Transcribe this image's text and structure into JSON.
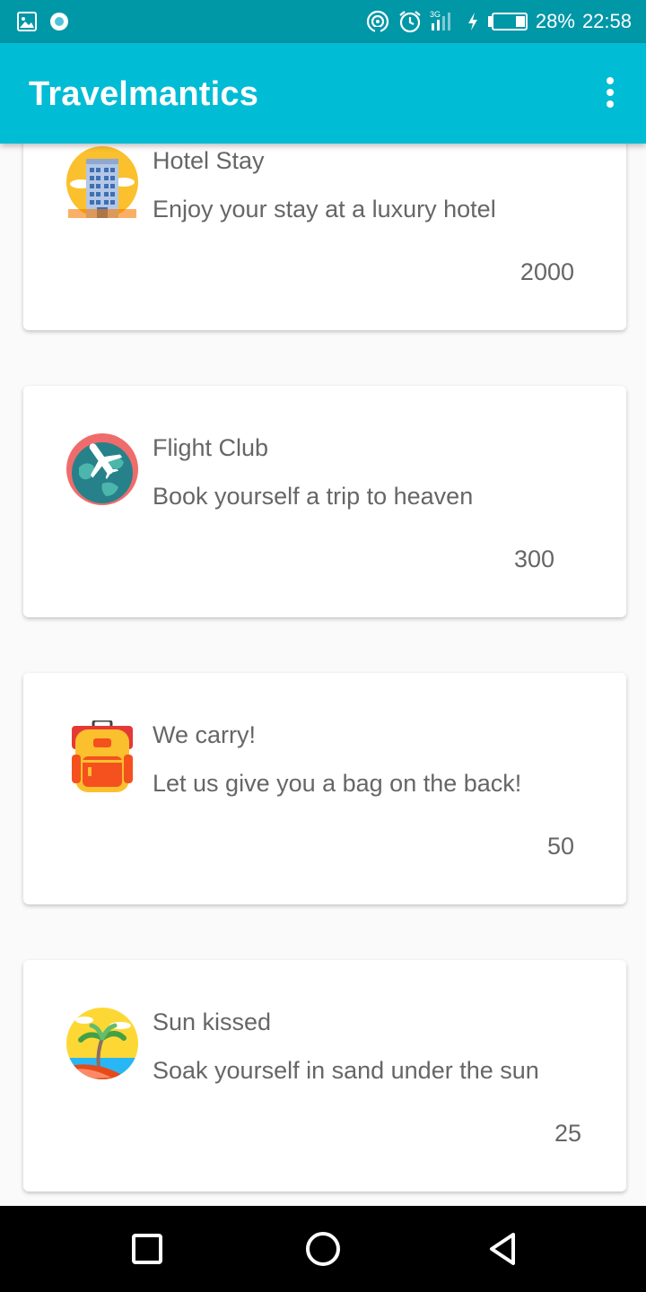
{
  "status_bar": {
    "battery": "28%",
    "time": "22:58",
    "network": "3G",
    "icons": [
      "gallery-icon",
      "notification-dot-icon",
      "hotspot-icon",
      "alarm-icon",
      "signal-icon",
      "charging-icon",
      "battery-icon"
    ]
  },
  "app_bar": {
    "title": "Travelmantics",
    "overflow_icon": "more-vert-icon"
  },
  "deals": [
    {
      "title": "Hotel Stay",
      "description": "Enjoy your stay at a luxury hotel",
      "price": "2000",
      "icon": "hotel-icon"
    },
    {
      "title": "Flight Club",
      "description": "Book yourself a trip to heaven",
      "price": "300",
      "icon": "airplane-globe-icon"
    },
    {
      "title": "We carry!",
      "description": "Let us give you a bag on the back!",
      "price": "50",
      "icon": "backpack-icon"
    },
    {
      "title": "Sun kissed",
      "description": "Soak yourself in sand under the sun",
      "price": "25",
      "icon": "beach-icon"
    }
  ],
  "nav_bar": {
    "icons": [
      "recents-icon",
      "home-icon",
      "back-icon"
    ]
  },
  "colors": {
    "status_bar": "#0097a7",
    "app_bar": "#00bcd4",
    "background": "#fafafa",
    "card": "#ffffff",
    "text": "#666666"
  }
}
